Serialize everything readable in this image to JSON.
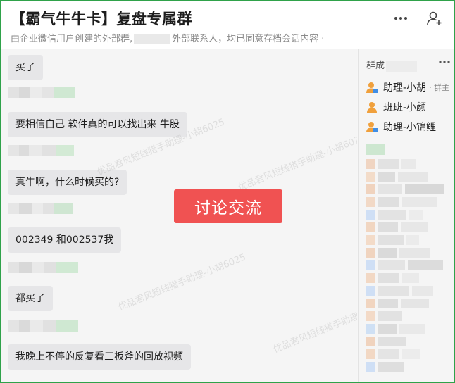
{
  "header": {
    "title": "【霸气牛牛卡】复盘专属群",
    "subtitle_prefix": "由企业微信用户创建的外部群,",
    "subtitle_suffix": "外部联系人，均已同意存档会话内容  ·",
    "more_icon": "more-icon",
    "add_member_icon": "add-member-icon"
  },
  "messages": [
    {
      "text": "买了"
    },
    {
      "text": "要相信自己  软件真的可以找出来 牛股"
    },
    {
      "text": "真牛啊，什么时候买的?"
    },
    {
      "text": "002349    和002537我"
    },
    {
      "text": "都买了"
    },
    {
      "text": "我晚上不停的反复看三板斧的回放视频"
    }
  ],
  "overlay": {
    "button_label": "讨论交流",
    "button_color": "#f05252",
    "watermark_text": "优品君风短线猎手助理-小胡6025"
  },
  "sidebar": {
    "title": "群成",
    "more_icon": "more-icon",
    "members": [
      {
        "name": "助理-小胡",
        "tag": "· 群主",
        "icon": "person-icon-blue"
      },
      {
        "name": "班班-小颜",
        "tag": "",
        "icon": "person-icon-orange"
      },
      {
        "name": "助理-小锦鲤",
        "tag": "",
        "icon": "person-icon-blue"
      }
    ]
  },
  "colors": {
    "border": "#2fa24a",
    "bubble": "#e6e6e8",
    "accent_orange": "#f0a03c",
    "accent_blue": "#3f8ee6"
  }
}
